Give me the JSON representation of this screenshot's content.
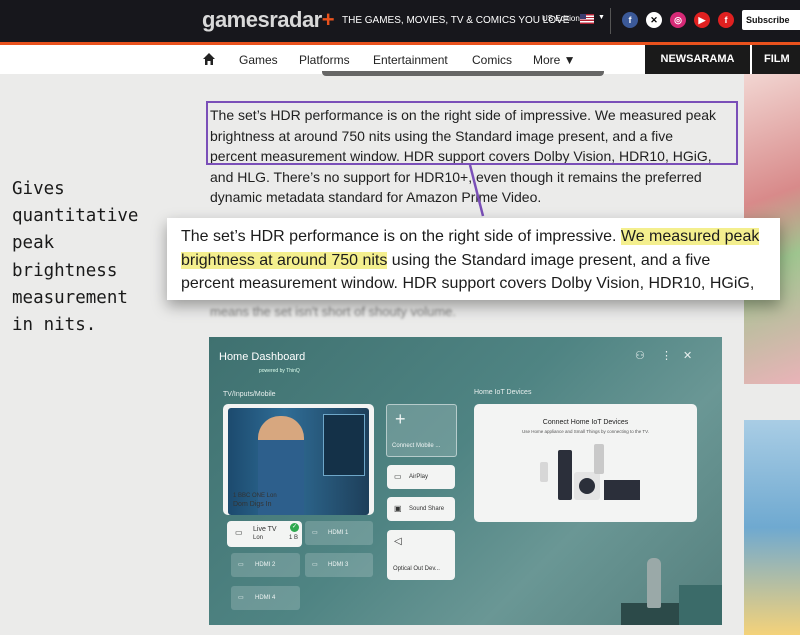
{
  "header": {
    "logo": "gamesradar",
    "logo_plus": "+",
    "tagline": "THE GAMES, MOVIES, TV & COMICS YOU LOVE",
    "edition": "US Edition",
    "subscribe": "Subscribe",
    "social_icons": [
      "facebook-icon",
      "x-icon",
      "instagram-icon",
      "youtube-icon",
      "flipboard-icon"
    ],
    "accent_color": "#e9521d"
  },
  "nav": {
    "items": [
      "Games",
      "Platforms",
      "Entertainment",
      "Comics",
      "More ▼"
    ],
    "newsarama": "NEWSARAMA",
    "film": "FILM"
  },
  "article": {
    "lines": [
      "The set’s HDR performance is on the right side of impressive. We measured peak",
      "brightness at around 750 nits using the Standard image present, and a five",
      "percent measurement window. HDR support covers Dolby Vision, HDR10, HGiG,",
      "and HLG. There’s no support for HDR10+, even though it remains the preferred",
      "dynamic metadata standard for Amazon Prime Video."
    ],
    "faded_line": "means the set isn't short of shouty volume."
  },
  "callout": {
    "line1_pre": "The set’s HDR performance is on the right side of impressive. ",
    "line1_hl": "We measured peak",
    "line2_hl": "brightness at around 750 nits",
    "line2_post": " using the Standard image present, and a five",
    "line3": "percent measurement window. HDR support covers Dolby Vision, HDR10, HGiG,",
    "highlight_color": "#f4ef8e",
    "box_color": "#7a4fb8"
  },
  "annotation": {
    "lines": [
      "Gives",
      "quantitative",
      "peak",
      "brightness",
      "measurement",
      "in nits."
    ]
  },
  "tv": {
    "title": "Home Dashboard",
    "powered": "powered by ThinQ",
    "section_inputs": "TV/Inputs/Mobile",
    "section_iot": "Home IoT Devices",
    "channel": "1 BBC ONE Lon",
    "program": "Dom Digs In",
    "connect_mobile": "Connect Mobile ...",
    "airplay": "AirPlay",
    "sound_share": "Sound Share",
    "optical": "Optical Out Dev...",
    "live_tv": "Live TV",
    "live_tv_sub": "Lon",
    "live_tv_ch": "1 B",
    "hdmi1": "HDMI 1",
    "hdmi2": "HDMI 2",
    "hdmi3": "HDMI 3",
    "hdmi4": "HDMI 4",
    "iot_title": "Connect Home IoT Devices",
    "iot_sub": "Use Home appliance and Small Things by connecting to the TV."
  }
}
